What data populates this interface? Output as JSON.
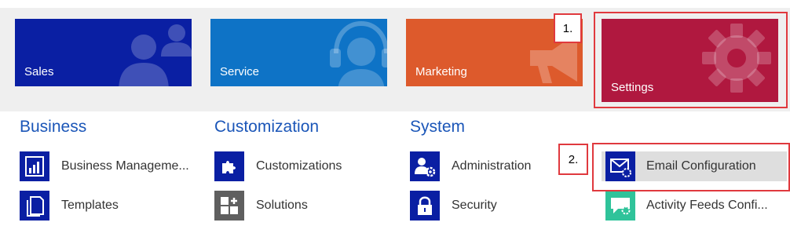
{
  "tiles": {
    "sales": {
      "label": "Sales",
      "icon": "people-icon",
      "color": "#0a1fa3"
    },
    "service": {
      "label": "Service",
      "icon": "headset-icon",
      "color": "#0e73c6"
    },
    "marketing": {
      "label": "Marketing",
      "icon": "megaphone-icon",
      "color": "#dd5a2c"
    },
    "settings": {
      "label": "Settings",
      "icon": "gear-icon",
      "color": "#b0183f"
    }
  },
  "callouts": {
    "step1": "1.",
    "step2": "2."
  },
  "groups": [
    {
      "title": "Business",
      "items": [
        {
          "label": "Business Manageme...",
          "icon": "business-management-icon"
        },
        {
          "label": "Templates",
          "icon": "templates-icon"
        }
      ]
    },
    {
      "title": "Customization",
      "items": [
        {
          "label": "Customizations",
          "icon": "puzzle-icon"
        },
        {
          "label": "Solutions",
          "icon": "solutions-icon"
        }
      ]
    },
    {
      "title": "System",
      "items": [
        {
          "label": "Administration",
          "icon": "administration-icon"
        },
        {
          "label": "Security",
          "icon": "lock-icon"
        }
      ]
    },
    {
      "title": "",
      "items": [
        {
          "label": "Email Configuration",
          "icon": "email-configuration-icon"
        },
        {
          "label": "Activity Feeds Confi...",
          "icon": "activity-feeds-icon"
        }
      ]
    }
  ],
  "colors": {
    "accent_blue": "#1b56b8",
    "icon_blue": "#0a1fa3",
    "annotation_red": "#e0393e",
    "activity_green": "#2fc39a"
  }
}
